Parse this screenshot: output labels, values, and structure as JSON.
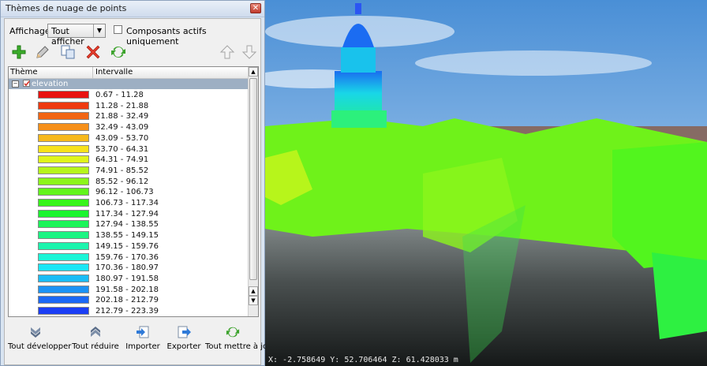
{
  "window": {
    "title": "Thèmes de nuage de points"
  },
  "display": {
    "label": "Affichage:",
    "selected": "Tout afficher",
    "checkbox_label": "Composants actifs uniquement"
  },
  "tree": {
    "col_theme": "Thème",
    "col_interval": "Intervalle",
    "root": "elevation",
    "items": [
      {
        "range": "0.67 - 11.28",
        "color": "#e8120f"
      },
      {
        "range": "11.28 - 21.88",
        "color": "#ee3a10"
      },
      {
        "range": "21.88 - 32.49",
        "color": "#f26514"
      },
      {
        "range": "32.49 - 43.09",
        "color": "#f6901a"
      },
      {
        "range": "43.09 - 53.70",
        "color": "#f7b91b"
      },
      {
        "range": "53.70 - 64.31",
        "color": "#f7e21b"
      },
      {
        "range": "64.31 - 74.91",
        "color": "#e0f51b"
      },
      {
        "range": "74.91 - 85.52",
        "color": "#b6f51b"
      },
      {
        "range": "85.52 - 96.12",
        "color": "#8cf51b"
      },
      {
        "range": "96.12 - 106.73",
        "color": "#62f51b"
      },
      {
        "range": "106.73 - 117.34",
        "color": "#38f51b"
      },
      {
        "range": "117.34 - 127.94",
        "color": "#1bf52f"
      },
      {
        "range": "127.94 - 138.55",
        "color": "#1bf559"
      },
      {
        "range": "138.55 - 149.15",
        "color": "#1bf583"
      },
      {
        "range": "149.15 - 159.76",
        "color": "#1bf5ad"
      },
      {
        "range": "159.76 - 170.36",
        "color": "#1bf5d7"
      },
      {
        "range": "170.36 - 180.97",
        "color": "#1be6f5"
      },
      {
        "range": "180.97 - 191.58",
        "color": "#1bbcf5"
      },
      {
        "range": "191.58 - 202.18",
        "color": "#1b92f5"
      },
      {
        "range": "202.18 - 212.79",
        "color": "#1b68f5"
      },
      {
        "range": "212.79 - 223.39",
        "color": "#1b3ef5"
      }
    ]
  },
  "buttons": {
    "expand": "Tout développer",
    "collapse": "Tout réduire",
    "import": "Importer",
    "export": "Exporter",
    "update": "Tout mettre à jour"
  },
  "viewport": {
    "coords": "X: -2.758649 Y: 52.706464 Z: 61.428033 m"
  }
}
